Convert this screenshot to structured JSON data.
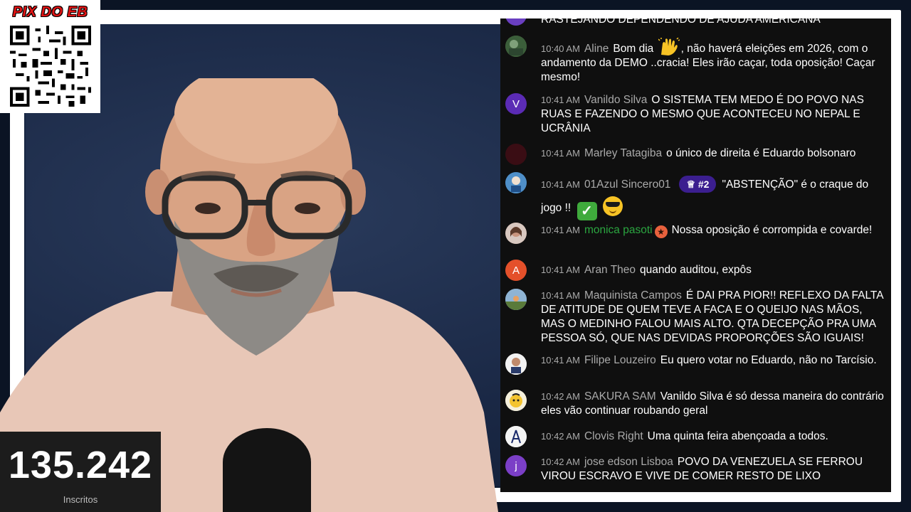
{
  "overlay": {
    "pix_title": "PIX DO EB",
    "subscriber_count": "135.242",
    "subscriber_label": "Inscritos"
  },
  "chat": {
    "partial_top_text": "RASTEJANDO DEPENDENDO DE AJUDA AMERICANA",
    "messages": [
      {
        "time": "10:40 AM",
        "author": "Aline",
        "text_before": "Bom dia",
        "emoji": "raising-hands",
        "text_after": ", não haverá eleições em 2026, com o andamento da DEMO ..cracia! Eles irão caçar, toda oposição! Caçar mesmo!",
        "avatar_color": "#4a6b3a"
      },
      {
        "time": "10:41 AM",
        "author": "Vanildo Silva",
        "text": "O SISTEMA TEM MEDO É DO POVO NAS RUAS E FAZENDO O MESMO QUE ACONTECEU NO NEPAL E UCRÂNIA",
        "avatar_letter": "V",
        "avatar_color": "#5b2bb5"
      },
      {
        "time": "10:41 AM",
        "author": "Marley Tatagiba",
        "text": "o único de direita é Eduardo bolsonaro",
        "avatar_color": "#3a0d14"
      },
      {
        "time": "10:41 AM",
        "author": "01Azul Sincero01",
        "badge": "#2",
        "text": "\"ABSTENÇÃO\" é o craque do jogo !!",
        "avatar_color": "#2f6fa8"
      },
      {
        "time": "10:41 AM",
        "author": "monica pasoti",
        "text": "Nossa oposição é corrompida e covarde!",
        "avatar_color": "#b88a7a"
      },
      {
        "time": "10:41 AM",
        "author": "Aran Theo",
        "text": "quando auditou, expôs",
        "avatar_letter": "A",
        "avatar_color": "#e4502a"
      },
      {
        "time": "10:41 AM",
        "author": "Maquinista Campos",
        "text": "É DAI PRA PIOR!! REFLEXO DA FALTA DE ATITUDE DE QUEM TEVE A FACA E O QUEIJO NAS MÃOS, MAS O MEDINHO FALOU MAIS ALTO. QTA DECEPÇÃO PRA UMA PESSOA SÓ, QUE NAS DEVIDAS PROPORÇÕES SÃO IGUAIS!",
        "avatar_color": "#6b8fb0"
      },
      {
        "time": "10:41 AM",
        "author": "Filipe Louzeiro",
        "text": "Eu quero votar no Eduardo, não no Tarcísio.",
        "avatar_color": "#e8e8e8"
      },
      {
        "time": "10:42 AM",
        "author": "SAKURA SAM",
        "text": "Vanildo Silva é só dessa maneira do contrário eles vão continuar roubando geral",
        "avatar_color": "#f2f0e6"
      },
      {
        "time": "10:42 AM",
        "author": "Clovis Right",
        "text": "Uma quinta feira abençoada a todos.",
        "avatar_color": "#f4f4f4"
      },
      {
        "time": "10:42 AM",
        "author": "jose edson Lisboa",
        "text": "POVO DA VENEZUELA SE FERROU VIROU ESCRAVO E VIVE DE COMER RESTO DE LIXO",
        "avatar_letter": "j",
        "avatar_color": "#7b3fc7"
      }
    ]
  }
}
